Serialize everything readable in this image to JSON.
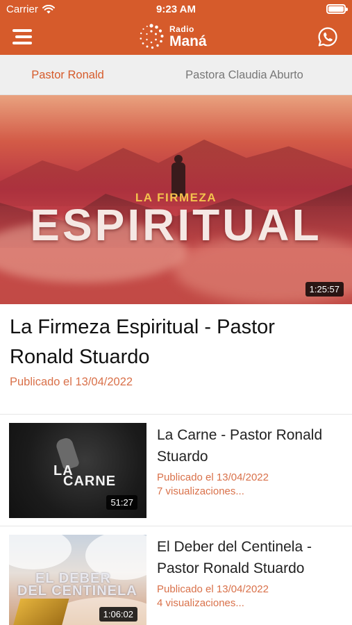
{
  "status_bar": {
    "carrier": "Carrier",
    "time": "9:23 AM"
  },
  "header": {
    "logo_radio": "Radio",
    "logo_mana": "Maná",
    "bg_color": "#d65b2b"
  },
  "tabs": [
    {
      "label": "Pastor Ronald",
      "active": true
    },
    {
      "label": "Pastora Claudia Aburto",
      "active": false
    }
  ],
  "featured": {
    "thumb_subtitle": "LA FIRMEZA",
    "thumb_title": "ESPIRITUAL",
    "duration": "1:25:57",
    "title": "La Firmeza Espiritual -  Pastor Ronald Stuardo",
    "date": "Publicado el 13/04/2022"
  },
  "videos": [
    {
      "thumb_line1": "LA",
      "thumb_line2": "CARNE",
      "duration": "51:27",
      "title": "La Carne - Pastor Ronald Stuardo",
      "date": "Publicado el 13/04/2022",
      "views": "7 visualizaciones..."
    },
    {
      "thumb_line1": "EL DEBER",
      "thumb_line2": "DEL CENTINELA",
      "duration": "1:06:02",
      "title": "El Deber del Centinela - Pastor Ronald Stuardo",
      "date": "Publicado el 13/04/2022",
      "views": "4 visualizaciones..."
    }
  ],
  "colors": {
    "accent": "#d65b2b",
    "date_text": "#d9714a",
    "tab_bg": "#efefef"
  },
  "icons": {
    "menu": "hamburger-menu-icon",
    "whatsapp": "whatsapp-icon",
    "wifi": "wifi-icon",
    "battery": "battery-icon",
    "logo": "radio-mana-logo"
  }
}
